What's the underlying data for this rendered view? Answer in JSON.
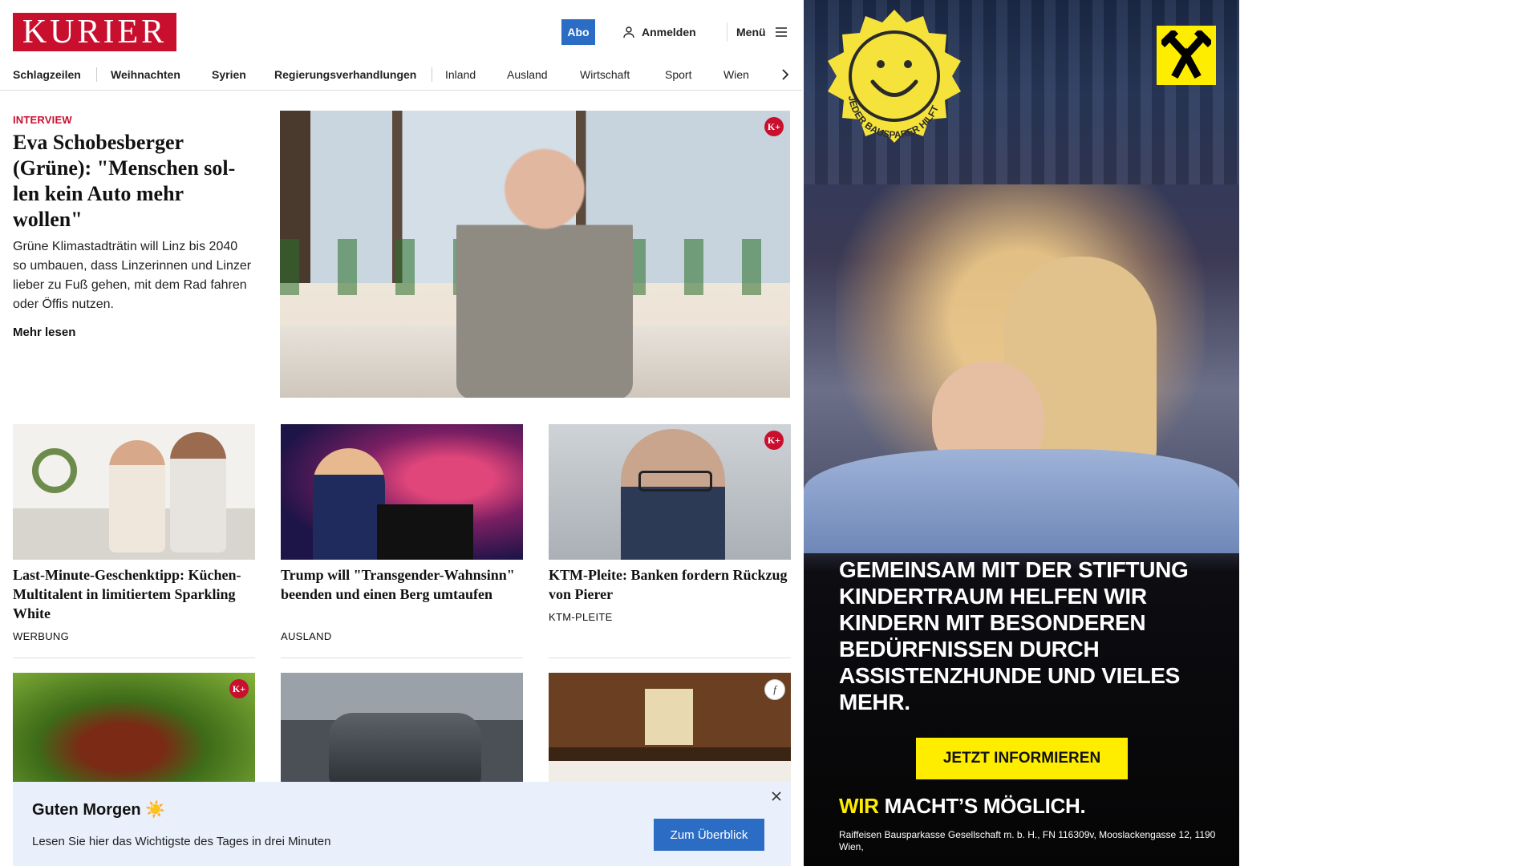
{
  "header": {
    "logo_text": "KURIER",
    "abo_label": "Abo",
    "login_label": "Anmelden",
    "menu_label": "Menü"
  },
  "nav": {
    "items": [
      "Schlagzeilen",
      "Weihnachten",
      "Syrien",
      "Regierungsverhandlungen",
      "Inland",
      "Ausland",
      "Wirtschaft",
      "Sport",
      "Wien"
    ]
  },
  "hero": {
    "kicker": "INTERVIEW",
    "title": "Eva Schobesberger (Grüne): \"Menschen sol­len kein Auto mehr wollen\"",
    "lead": "Grüne Klimastadträtin will Linz bis 2040 so umbauen, dass Linzerinnen und Linzer lieber zu Fuß gehen, mit dem Rad fahren oder Öffis nutzen.",
    "more_label": "Mehr lesen",
    "badge": "K+"
  },
  "cards": [
    {
      "title": "Last-Minute-Geschenktipp: Kü­chen-Multitalent in limitiertem Sparkling White",
      "tag": "WERBUNG"
    },
    {
      "title": "Trump will \"Transgender-Wahn­sinn\" beenden und einen Berg umtaufen",
      "tag": "AUSLAND"
    },
    {
      "title": "KTM-Pleite: Banken fordern Rück­zug von Pierer",
      "tag": "KTM-PLEITE",
      "badge": "K+"
    }
  ],
  "row2_badges": {
    "first": "K+",
    "third": "f"
  },
  "morning": {
    "title": "Guten Morgen ☀️",
    "text": "Lesen Sie hier das Wichtigste des Tages in drei Minuten",
    "button": "Zum Überblick"
  },
  "ad": {
    "badge_text": "JEDER BAUSPARER HILFT",
    "headline": "GEMEINSAM MIT DER STIFTUNG KINDERTRAUM HELFEN WIR KINDERN MIT BESONDEREN BEDÜRFNISSEN DURCH ASSISTENZHUNDE UND VIELES MEHR.",
    "cta": "JETZT INFORMIEREN",
    "slogan_wir": "WIR",
    "slogan_rest": " MACHT’S MÖGLICH.",
    "legal": "Raiffeisen Bausparkasse Gesellschaft m. b. H., FN 116309v, Mooslackengasse 12, 1190 Wien,",
    "colors": {
      "yellow": "#ffed00",
      "dark": "#0d0d12"
    }
  },
  "colors": {
    "brand_red": "#c8102e",
    "accent_blue": "#2b6cc4",
    "banner_bg": "#e9f0fb"
  }
}
